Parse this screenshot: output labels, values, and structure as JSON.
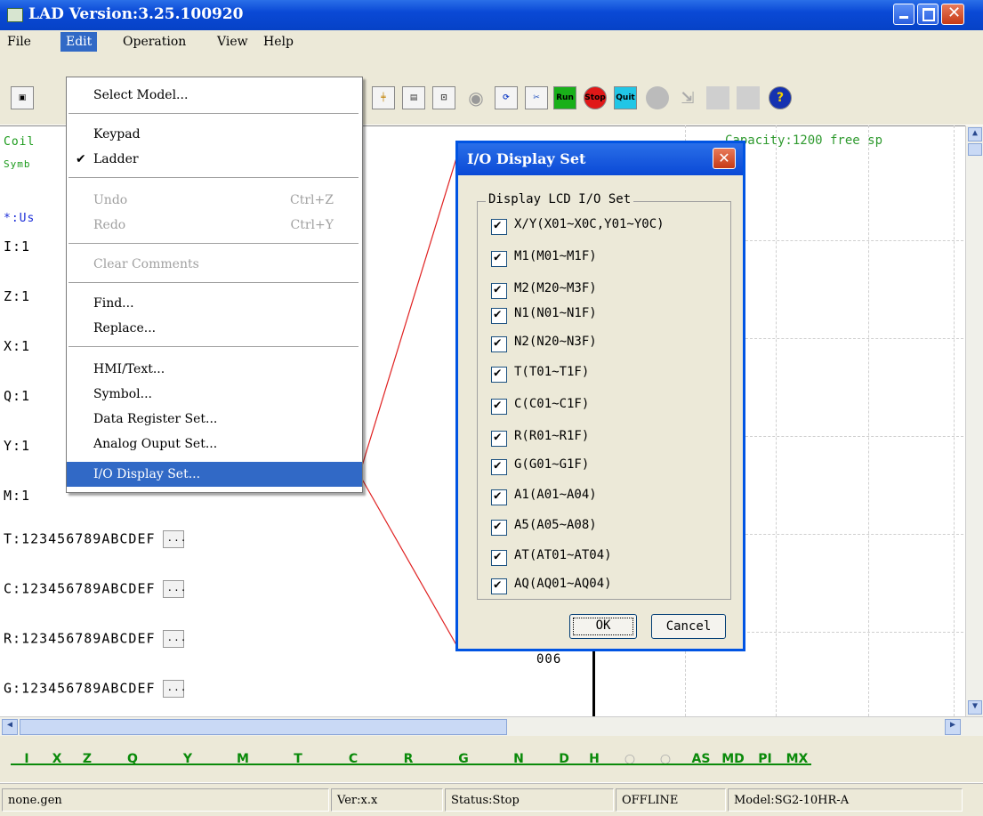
{
  "window": {
    "title": "LAD Version:3.25.100920"
  },
  "menubar": {
    "file": "File",
    "edit": "Edit",
    "operation": "Operation",
    "view": "View",
    "help": "Help"
  },
  "edit_menu": {
    "select_model": "Select Model...",
    "keypad": "Keypad",
    "ladder": "Ladder",
    "ladder_check": "✔",
    "undo": "Undo",
    "undo_shortcut": "Ctrl+Z",
    "redo": "Redo",
    "redo_shortcut": "Ctrl+Y",
    "clear_comments": "Clear Comments",
    "find": "Find...",
    "replace": "Replace...",
    "hmi_text": "HMI/Text...",
    "symbol": "Symbol...",
    "data_register_set": "Data Register Set...",
    "analog_output_set": "Analog Ouput Set...",
    "io_display_set": "I/O Display Set..."
  },
  "toolbar": {
    "run": "Run",
    "stop": "Stop",
    "quit": "Quit"
  },
  "main": {
    "coil_prefix": "Coil",
    "symb_prefix": "Symb",
    "capacity": "Capacity:1200 free sp",
    "note_prefix": "*:Us",
    "rows": [
      {
        "prefix": "I:1"
      },
      {
        "prefix": "Z:1"
      },
      {
        "prefix": "X:1"
      },
      {
        "prefix": "Q:1"
      },
      {
        "prefix": "Y:1"
      },
      {
        "prefix": "M:1"
      }
    ],
    "full_rows": [
      {
        "label": "T:123456789ABCDEF"
      },
      {
        "label": "C:123456789ABCDEF"
      },
      {
        "label": "R:123456789ABCDEF"
      },
      {
        "label": "G:123456789ABCDEF"
      }
    ],
    "line_number": "006"
  },
  "dialog": {
    "title": "I/O Display Set",
    "group": "Display LCD I/O Set",
    "items": [
      {
        "label": "X/Y(X01~X0C,Y01~Y0C)",
        "checked": true
      },
      {
        "label": "M1(M01~M1F)",
        "checked": true
      },
      {
        "label": "M2(M20~M3F)",
        "checked": true
      },
      {
        "label": "N1(N01~N1F)",
        "checked": true
      },
      {
        "label": "N2(N20~N3F)",
        "checked": true
      },
      {
        "label": "T(T01~T1F)",
        "checked": true
      },
      {
        "label": "C(C01~C1F)",
        "checked": true
      },
      {
        "label": "R(R01~R1F)",
        "checked": true
      },
      {
        "label": "G(G01~G1F)",
        "checked": true
      },
      {
        "label": "A1(A01~A04)",
        "checked": true
      },
      {
        "label": "A5(A05~A08)",
        "checked": true
      },
      {
        "label": "AT(AT01~AT04)",
        "checked": true
      },
      {
        "label": "AQ(AQ01~AQ04)",
        "checked": true
      }
    ],
    "ok": "OK",
    "cancel": "Cancel"
  },
  "bottom_toolbar": {
    "letters": [
      "I",
      "X",
      "Z",
      "Q",
      "Y",
      "M",
      "T",
      "C",
      "R",
      "G",
      "N",
      "D",
      "H",
      "",
      "",
      "AS",
      "MD",
      "PI",
      "MX"
    ]
  },
  "statusbar": {
    "file": "none.gen",
    "ver": "Ver:x.x",
    "status": "Status:Stop",
    "mode": "OFFLINE",
    "model": "Model:SG2-10HR-A"
  },
  "colors": {
    "titlebar": "#0a49d6",
    "highlight": "#3169c6",
    "capacity_text": "#2f9a2f",
    "symbol_text": "#1a9a1a",
    "note_blue": "#1c2ed8",
    "ladder_green": "#0a8a0a"
  }
}
